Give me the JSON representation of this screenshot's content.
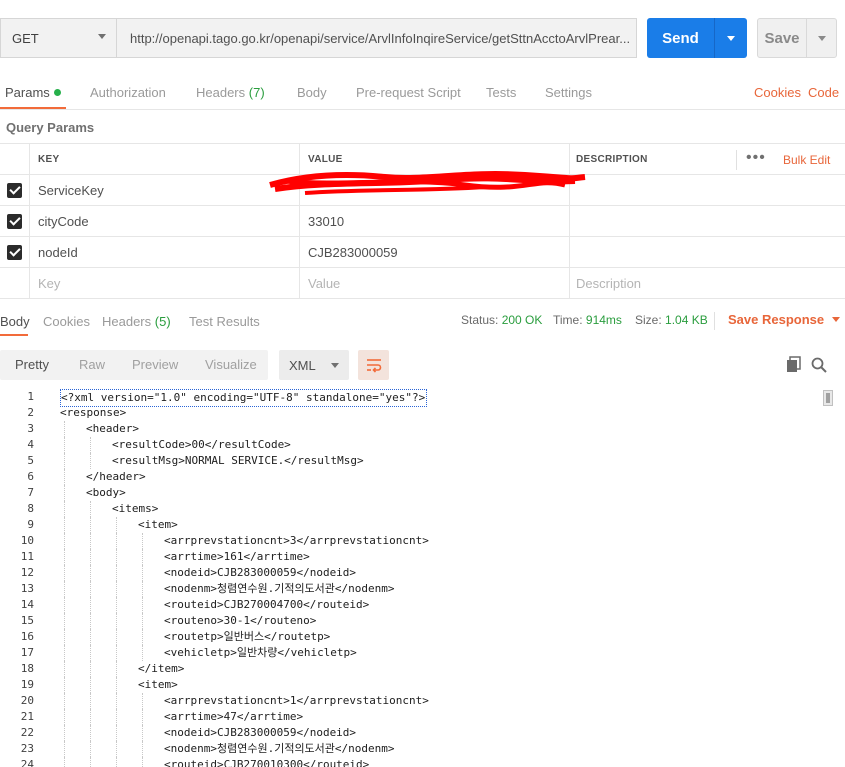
{
  "request": {
    "method": "GET",
    "url": "http://openapi.tago.go.kr/openapi/service/ArvlInfoInqireService/getSttnAcctoArvlPrear...",
    "send_label": "Send",
    "save_label": "Save"
  },
  "request_tabs": {
    "params": "Params",
    "authorization": "Authorization",
    "headers": "Headers",
    "headers_count": "(7)",
    "body": "Body",
    "prerequest": "Pre-request Script",
    "tests": "Tests",
    "settings": "Settings",
    "cookies": "Cookies",
    "code": "Code"
  },
  "query_params": {
    "title": "Query Params",
    "columns": {
      "key": "KEY",
      "value": "VALUE",
      "description": "DESCRIPTION"
    },
    "bulk_edit": "Bulk Edit",
    "rows": [
      {
        "key": "ServiceKey",
        "value": "",
        "description": ""
      },
      {
        "key": "cityCode",
        "value": "33010",
        "description": ""
      },
      {
        "key": "nodeId",
        "value": "CJB283000059",
        "description": ""
      }
    ],
    "placeholder": {
      "key": "Key",
      "value": "Value",
      "description": "Description"
    }
  },
  "response_tabs": {
    "body": "Body",
    "cookies": "Cookies",
    "headers": "Headers",
    "headers_count": "(5)",
    "test_results": "Test Results"
  },
  "response_status": {
    "status_label": "Status:",
    "status_value": "200 OK",
    "time_label": "Time:",
    "time_value": "914ms",
    "size_label": "Size:",
    "size_value": "1.04 KB",
    "save_response": "Save Response"
  },
  "body_toolbar": {
    "modes": [
      "Pretty",
      "Raw",
      "Preview",
      "Visualize"
    ],
    "format": "XML"
  },
  "code_lines": [
    {
      "n": "1",
      "indent": 0,
      "text": "<?xml version=\"1.0\" encoding=\"UTF-8\" standalone=\"yes\"?>"
    },
    {
      "n": "2",
      "indent": 0,
      "text": "<response>"
    },
    {
      "n": "3",
      "indent": 1,
      "text": "<header>"
    },
    {
      "n": "4",
      "indent": 2,
      "text": "<resultCode>00</resultCode>"
    },
    {
      "n": "5",
      "indent": 2,
      "text": "<resultMsg>NORMAL SERVICE.</resultMsg>"
    },
    {
      "n": "6",
      "indent": 1,
      "text": "</header>"
    },
    {
      "n": "7",
      "indent": 1,
      "text": "<body>"
    },
    {
      "n": "8",
      "indent": 2,
      "text": "<items>"
    },
    {
      "n": "9",
      "indent": 3,
      "text": "<item>"
    },
    {
      "n": "10",
      "indent": 4,
      "text": "<arrprevstationcnt>3</arrprevstationcnt>"
    },
    {
      "n": "11",
      "indent": 4,
      "text": "<arrtime>161</arrtime>"
    },
    {
      "n": "12",
      "indent": 4,
      "text": "<nodeid>CJB283000059</nodeid>"
    },
    {
      "n": "13",
      "indent": 4,
      "text": "<nodenm>청렴연수원.기적의도서관</nodenm>"
    },
    {
      "n": "14",
      "indent": 4,
      "text": "<routeid>CJB270004700</routeid>"
    },
    {
      "n": "15",
      "indent": 4,
      "text": "<routeno>30-1</routeno>"
    },
    {
      "n": "16",
      "indent": 4,
      "text": "<routetp>일반버스</routetp>"
    },
    {
      "n": "17",
      "indent": 4,
      "text": "<vehicletp>일반차량</vehicletp>"
    },
    {
      "n": "18",
      "indent": 3,
      "text": "</item>"
    },
    {
      "n": "19",
      "indent": 3,
      "text": "<item>"
    },
    {
      "n": "20",
      "indent": 4,
      "text": "<arrprevstationcnt>1</arrprevstationcnt>"
    },
    {
      "n": "21",
      "indent": 4,
      "text": "<arrtime>47</arrtime>"
    },
    {
      "n": "22",
      "indent": 4,
      "text": "<nodeid>CJB283000059</nodeid>"
    },
    {
      "n": "23",
      "indent": 4,
      "text": "<nodenm>청렴연수원.기적의도서관</nodenm>"
    },
    {
      "n": "24",
      "indent": 4,
      "text": "<routeid>CJB270010300</routeid>"
    }
  ],
  "colors": {
    "accent": "#f26b3a",
    "send": "#1a7de8",
    "ok": "#2a9d3e",
    "redaction": "#ff0000"
  }
}
